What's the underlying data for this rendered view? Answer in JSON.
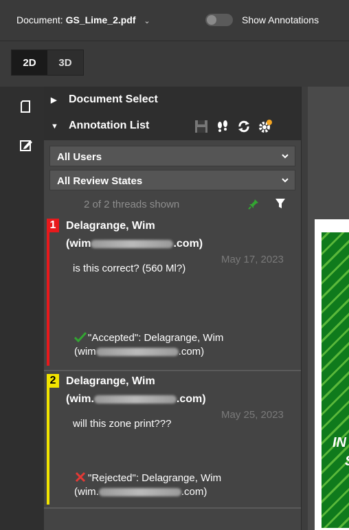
{
  "header": {
    "doc_prefix": "Document:",
    "doc_name": "GS_Lime_2.pdf",
    "annotations_toggle_label": "Show Annotations",
    "annotations_on": false
  },
  "view_modes": {
    "mode_2d": "2D",
    "mode_3d": "3D",
    "active": "2D"
  },
  "panel": {
    "document_select": "Document Select",
    "annotation_list": "Annotation List",
    "user_filter": "All Users",
    "state_filter": "All Review States",
    "threads_shown": "2 of 2 threads shown"
  },
  "threads": [
    {
      "number": "1",
      "color": "#e8191c",
      "author": "Delagrange, Wim",
      "email_start": "(wim",
      "email_end": ".com)",
      "date": "May 17, 2023",
      "text": "is this correct? (560 Ml?)",
      "review_state": "\"Accepted\": Delagrange, Wim",
      "review_email_start": "(wim",
      "review_email_end": ".com)",
      "status_icon": "check-icon"
    },
    {
      "number": "2",
      "color": "#f2e400",
      "author": "Delagrange, Wim",
      "email_start": "(wim.",
      "email_end": ".com)",
      "date": "May 25, 2023",
      "text": "will this zone print???",
      "review_state": "\"Rejected\": Delagrange, Wim",
      "review_email_start": "(wim.",
      "review_email_end": ".com)",
      "status_icon": "cross-icon"
    }
  ],
  "colors": {
    "accent_green": "#33a532",
    "reject_red": "#e53935"
  },
  "canvas": {
    "visible_text_1": "IN",
    "visible_text_2": "S"
  }
}
